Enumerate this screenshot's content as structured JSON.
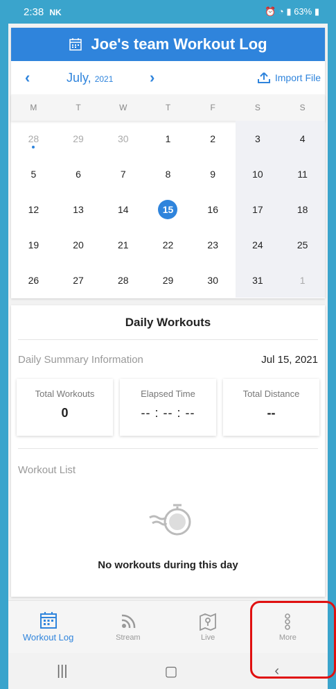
{
  "status_bar": {
    "time": "2:38",
    "carrier_icon": "NK",
    "right": "63%"
  },
  "header": {
    "title": "Joe's team Workout Log"
  },
  "calendar": {
    "prev_symbol": "‹",
    "month": "July,",
    "year": "2021",
    "next_symbol": "›",
    "import_label": "Import File",
    "days_of_week": [
      "M",
      "T",
      "W",
      "T",
      "F",
      "S",
      "S"
    ],
    "weeks": [
      [
        "28",
        "29",
        "30",
        "1",
        "2",
        "3",
        "4"
      ],
      [
        "5",
        "6",
        "7",
        "8",
        "9",
        "10",
        "11"
      ],
      [
        "12",
        "13",
        "14",
        "15",
        "16",
        "17",
        "18"
      ],
      [
        "19",
        "20",
        "21",
        "22",
        "23",
        "24",
        "25"
      ],
      [
        "26",
        "27",
        "28",
        "29",
        "30",
        "31",
        "1"
      ]
    ],
    "selected_day": "15",
    "accent": "#2f84dc"
  },
  "daily": {
    "title": "Daily Workouts",
    "summary_label": "Daily Summary Information",
    "date": "Jul 15, 2021",
    "stats": [
      {
        "label": "Total Workouts",
        "value": "0"
      },
      {
        "label": "Elapsed Time",
        "value": "-- : -- : --"
      },
      {
        "label": "Total Distance",
        "value": "--"
      }
    ],
    "list_label": "Workout List",
    "empty_text": "No workouts during this day"
  },
  "nav": {
    "items": [
      {
        "label": "Workout Log",
        "icon": "calendar-icon"
      },
      {
        "label": "Stream",
        "icon": "stream-icon"
      },
      {
        "label": "Live",
        "icon": "map-icon"
      },
      {
        "label": "More",
        "icon": "more-icon"
      }
    ]
  }
}
